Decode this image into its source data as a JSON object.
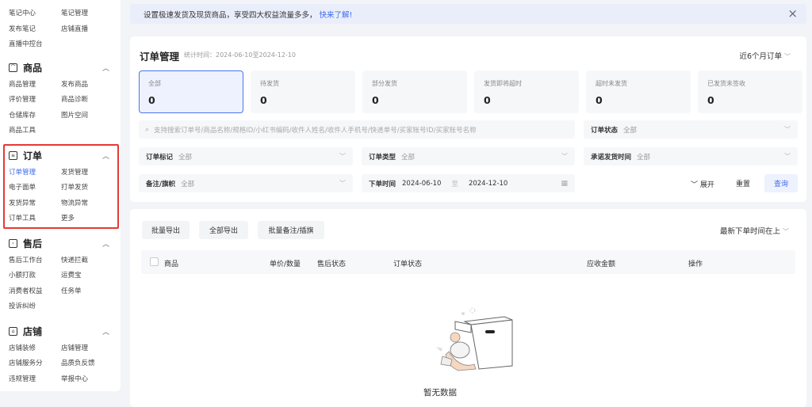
{
  "sidebar": {
    "top_links": [
      "笔记中心",
      "笔记管理",
      "发布笔记",
      "店铺直播",
      "直播中控台"
    ],
    "sections": [
      {
        "title": "商品",
        "icon": "goods-icon",
        "links": [
          "商品管理",
          "发布商品",
          "评价管理",
          "商品诊断",
          "仓储库存",
          "图片空间",
          "商品工具"
        ]
      },
      {
        "title": "订单",
        "icon": "order-icon",
        "links": [
          "订单管理",
          "发货管理",
          "电子面单",
          "打单发货",
          "发货异常",
          "物流异常",
          "订单工具",
          "更多"
        ],
        "active_link": "订单管理"
      },
      {
        "title": "售后",
        "icon": "aftersale-icon",
        "links": [
          "售后工作台",
          "快递拦截",
          "小额打款",
          "运费宝",
          "消费者权益",
          "任务单",
          "投诉纠纷"
        ]
      },
      {
        "title": "店铺",
        "icon": "shop-icon",
        "links": [
          "店铺装修",
          "店铺管理",
          "店铺服务分",
          "品质负反馈",
          "违规管理",
          "举报中心"
        ]
      }
    ]
  },
  "banner": {
    "text": "设置极速发货及现货商品，享受四大权益流量多多，",
    "link": "快来了解!",
    "close": "×"
  },
  "order_panel": {
    "title": "订单管理",
    "subtitle": "统计时间：2024-06-10至2024-12-10",
    "range": "近6个月订单",
    "tabs": [
      {
        "label": "全部",
        "count": "0"
      },
      {
        "label": "待发货",
        "count": "0"
      },
      {
        "label": "部分发货",
        "count": "0"
      },
      {
        "label": "发货即将超时",
        "count": "0"
      },
      {
        "label": "超时未发货",
        "count": "0"
      },
      {
        "label": "已发货未签收",
        "count": "0"
      }
    ],
    "search_placeholder": "支持搜索订单号/商品名称/规格ID/小红书编码/收件人姓名/收件人手机号/快递单号/买家账号ID/买家账号名称",
    "filters": {
      "status": {
        "label": "订单状态",
        "value": "全部"
      },
      "mark": {
        "label": "订单标记",
        "value": "全部"
      },
      "type": {
        "label": "订单类型",
        "value": "全部"
      },
      "promise": {
        "label": "承诺发货时间",
        "value": "全部"
      },
      "remark": {
        "label": "备注/旗帜",
        "value": "全部"
      }
    },
    "date": {
      "label": "下单时间",
      "from": "2024-06-10",
      "sep": "至",
      "to": "2024-12-10"
    },
    "expand": "展开",
    "reset": "重置",
    "query": "查询"
  },
  "list_panel": {
    "buttons": [
      "批量导出",
      "全部导出",
      "批量备注/插旗"
    ],
    "sort": "最新下单时间在上",
    "columns": [
      "商品",
      "单价/数量",
      "售后状态",
      "订单状态",
      "应收金额",
      "操作"
    ],
    "empty": "暂无数据"
  },
  "colors": {
    "accent": "#3f6ae8",
    "highlight_box": "#e53935"
  }
}
